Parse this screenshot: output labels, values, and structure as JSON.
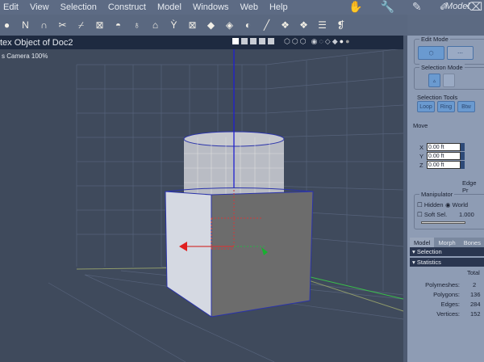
{
  "menubar": {
    "items": [
      "Edit",
      "View",
      "Selection",
      "Construct",
      "Model",
      "Windows",
      "Web",
      "Help"
    ],
    "room_title": "Model"
  },
  "viewport": {
    "title": "tex Object of Doc2",
    "camera": "s Camera 100%"
  },
  "panel": {
    "edit_mode": "Edit Mode",
    "selection_mode": "Selection Mode",
    "selection_tools": {
      "label": "Selection Tools",
      "buttons": [
        "Loop",
        "Ring",
        "Btw"
      ]
    },
    "move": "Move",
    "fields": [
      {
        "label": "X",
        "value": "0.00 ft"
      },
      {
        "label": "Y",
        "value": "0.00 ft"
      },
      {
        "label": "Z",
        "value": "0.00 ft"
      }
    ],
    "edge_label": "Edge Pr",
    "manipulator": {
      "label": "Manipulator",
      "hidden": "Hidden",
      "world": "World",
      "soft_sel": "Soft Sel.",
      "soft_value": "1.000"
    },
    "tabs": [
      "Model",
      "Morph",
      "Bones"
    ],
    "sections": {
      "selection": "Selection",
      "statistics": "Statistics"
    },
    "stats": {
      "header": "Total",
      "rows": [
        {
          "label": "Polymeshes:",
          "value": "2"
        },
        {
          "label": "Polygons:",
          "value": "136"
        },
        {
          "label": "Edges:",
          "value": "284"
        },
        {
          "label": "Vertices:",
          "value": "152"
        }
      ]
    }
  }
}
